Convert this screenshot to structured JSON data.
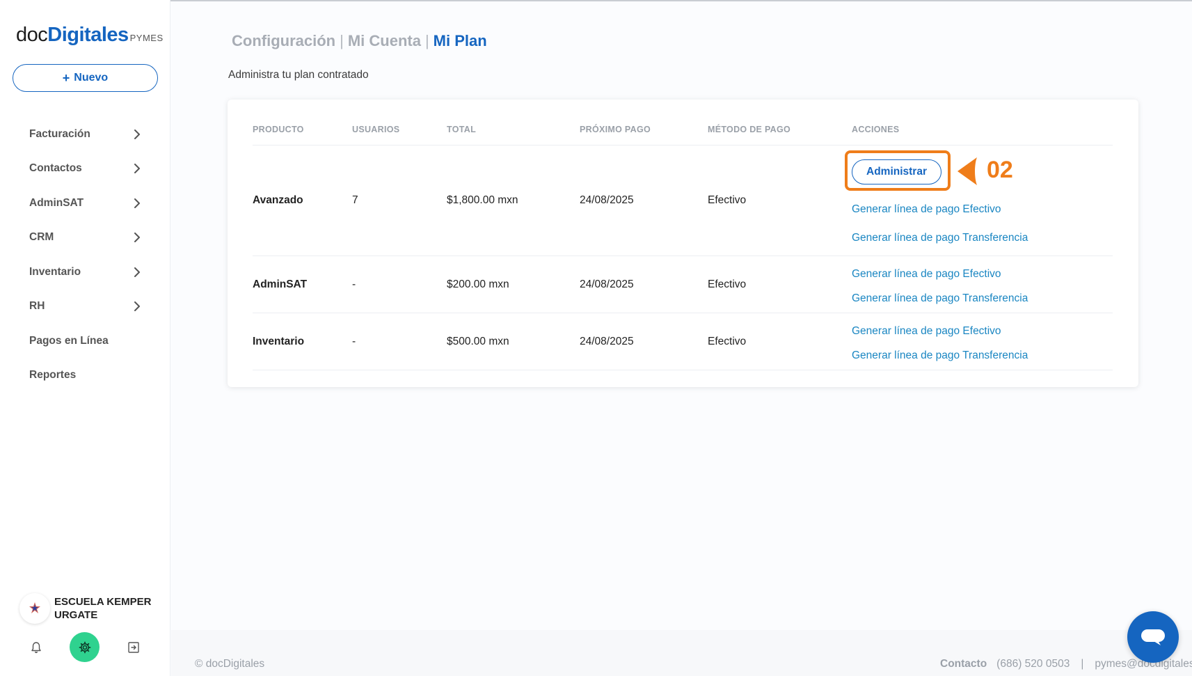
{
  "brand": {
    "logo_doc": "doc",
    "logo_digitales": "Digitales",
    "logo_pymes": "PYMES",
    "primary_color": "#1565c0",
    "accent_color": "#2fd28f",
    "highlight_color": "#ef7d1a"
  },
  "sidebar": {
    "new_button": {
      "plus": "+",
      "label": "Nuevo"
    },
    "items": [
      {
        "label": "Facturación",
        "has_chevron": true
      },
      {
        "label": "Contactos",
        "has_chevron": true
      },
      {
        "label": "AdminSAT",
        "has_chevron": true
      },
      {
        "label": "CRM",
        "has_chevron": true
      },
      {
        "label": "Inventario",
        "has_chevron": true
      },
      {
        "label": "RH",
        "has_chevron": true
      },
      {
        "label": "Pagos en Línea",
        "has_chevron": false
      },
      {
        "label": "Reportes",
        "has_chevron": false
      }
    ],
    "account_name": "ESCUELA KEMPER URGATE",
    "bottom_icons": [
      "bell-icon",
      "gear-icon",
      "logout-icon"
    ]
  },
  "header": {
    "breadcrumb": [
      "Configuración",
      "Mi Cuenta",
      "Mi Plan"
    ],
    "separator": "|",
    "subtitle": "Administra tu plan contratado"
  },
  "table": {
    "columns": [
      "PRODUCTO",
      "USUARIOS",
      "TOTAL",
      "PRÓXIMO PAGO",
      "MÉTODO DE PAGO",
      "ACCIONES"
    ],
    "rows": [
      {
        "producto": "Avanzado",
        "usuarios": "7",
        "total": "$1,800.00 mxn",
        "proximo_pago": "24/08/2025",
        "metodo": "Efectivo",
        "admin_button": "Administrar",
        "link_efectivo": "Generar línea de pago Efectivo",
        "link_transferencia": "Generar línea de pago Transferencia"
      },
      {
        "producto": "AdminSAT",
        "usuarios": "-",
        "total": "$200.00 mxn",
        "proximo_pago": "24/08/2025",
        "metodo": "Efectivo",
        "link_efectivo": "Generar línea de pago Efectivo",
        "link_transferencia": "Generar línea de pago Transferencia"
      },
      {
        "producto": "Inventario",
        "usuarios": "-",
        "total": "$500.00 mxn",
        "proximo_pago": "24/08/2025",
        "metodo": "Efectivo",
        "link_efectivo": "Generar línea de pago Efectivo",
        "link_transferencia": "Generar línea de pago Transferencia"
      }
    ]
  },
  "annotation": {
    "step": "02"
  },
  "footer": {
    "copyright": "© docDigitales",
    "contact_label": "Contacto",
    "phone": "(686) 520 0503",
    "separator": "|",
    "email": "pymes@docdigitales.com"
  }
}
